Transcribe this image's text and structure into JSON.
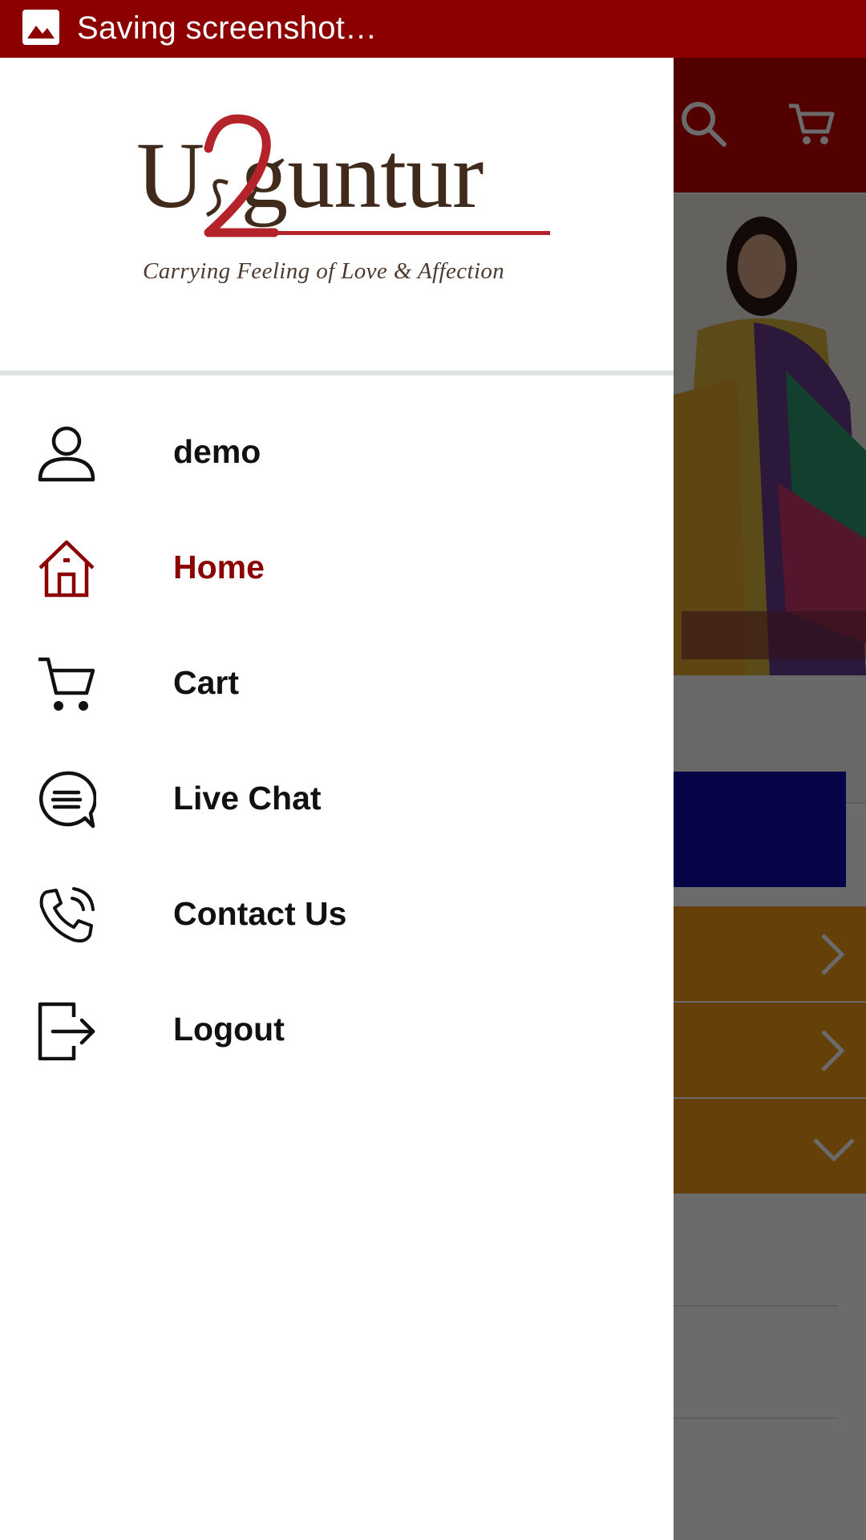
{
  "status_bar": {
    "text": "Saving screenshot…",
    "background": "#8c0000"
  },
  "background_app": {
    "toolbar_color": "#c30000",
    "toolbar_icons": [
      "search-icon",
      "cart-icon"
    ],
    "accent_blue": "#0a0aa8",
    "row_color": "#f29a17",
    "row_chevrons": [
      "chevron-right-icon",
      "chevron-right-icon",
      "chevron-down-icon"
    ]
  },
  "drawer": {
    "logo": {
      "wordmark": "U2guntur",
      "tagline": "Carrying Feeling of Love & Affection",
      "brand_brown": "#3f2a1c",
      "brand_red": "#b4232a"
    },
    "items": [
      {
        "label": "demo",
        "icon": "user-icon",
        "active": false
      },
      {
        "label": "Home",
        "icon": "home-icon",
        "active": true
      },
      {
        "label": "Cart",
        "icon": "cart-icon",
        "active": false
      },
      {
        "label": "Live Chat",
        "icon": "chat-icon",
        "active": false
      },
      {
        "label": "Contact Us",
        "icon": "phone-icon",
        "active": false
      },
      {
        "label": "Logout",
        "icon": "logout-icon",
        "active": false
      }
    ],
    "active_color": "#8c0000"
  }
}
